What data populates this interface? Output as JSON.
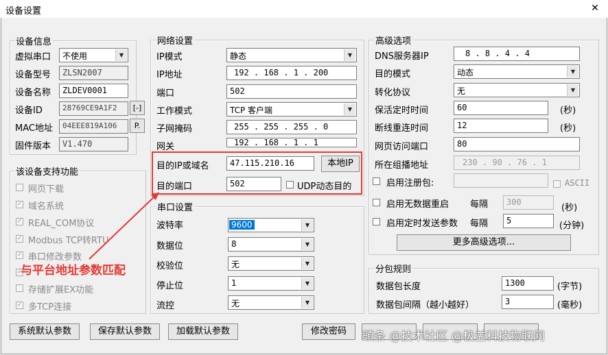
{
  "window": {
    "title": "设备设置",
    "close_icon": "✕"
  },
  "device_info": {
    "legend": "设备信息",
    "virtual_port": {
      "label": "虚拟串口",
      "value": "不使用"
    },
    "model": {
      "label": "设备型号",
      "value": "ZLSN2007"
    },
    "name": {
      "label": "设备名称",
      "value": "ZLDEV0001"
    },
    "id": {
      "label": "设备ID",
      "value": "28769CE9A1F2",
      "btn": "[-]"
    },
    "mac": {
      "label": "MAC地址",
      "value": "04EEE819A106",
      "btn": "P."
    },
    "firmware": {
      "label": "固件版本",
      "value": "V1.470"
    }
  },
  "features": {
    "legend": "该设备支持功能",
    "items": [
      "网页下载",
      "域名系统",
      "REAL_COM协议",
      "Modbus TCP转RTU",
      "串口修改参数",
      "",
      "存储扩展EX功能",
      "多TCP连接"
    ],
    "checked": [
      false,
      true,
      true,
      true,
      true,
      true,
      false,
      true
    ]
  },
  "network": {
    "legend": "网络设置",
    "ip_mode": {
      "label": "IP模式",
      "value": "静态"
    },
    "ip": {
      "label": "IP地址",
      "value": "192 . 168 . 1 . 200"
    },
    "port": {
      "label": "端口",
      "value": "502"
    },
    "work_mode": {
      "label": "工作模式",
      "value": "TCP 客户端"
    },
    "mask": {
      "label": "子网掩码",
      "value": "255 . 255 . 255 . 0"
    },
    "gateway": {
      "label": "网关",
      "value": "192 . 168 . 1 . 1"
    },
    "dest_ip": {
      "label": "目的IP或域名",
      "value": "47.115.210.16",
      "btn": "本地IP"
    },
    "dest_port": {
      "label": "目的端口",
      "value": "502"
    },
    "udp_dynamic": "UDP动态目的"
  },
  "serial": {
    "legend": "串口设置",
    "baud": {
      "label": "波特率",
      "value": "9600"
    },
    "data_bits": {
      "label": "数据位",
      "value": "8"
    },
    "parity": {
      "label": "校验位",
      "value": "无"
    },
    "stop_bits": {
      "label": "停止位",
      "value": "1"
    },
    "flow": {
      "label": "流控",
      "value": "无"
    }
  },
  "advanced": {
    "legend": "高级选项",
    "dns": {
      "label": "DNS服务器IP",
      "value": "8 . 8 . 4 . 4"
    },
    "dest_mode": {
      "label": "目的模式",
      "value": "动态"
    },
    "protocol": {
      "label": "转化协议",
      "value": "无"
    },
    "keepalive": {
      "label": "保活定时时间",
      "value": "60",
      "unit": "(秒)"
    },
    "reconnect": {
      "label": "断线重连时间",
      "value": "12",
      "unit": "(秒)"
    },
    "web_port": {
      "label": "网页访问端口",
      "value": "80"
    },
    "multicast": {
      "label": "所在组播地址",
      "value": "230 . 90 . 76 . 1"
    },
    "reg_pkt": {
      "label": "启用注册包:",
      "ascii": "ASCII"
    },
    "no_data_restart": {
      "label": "启用无数据重启",
      "every": "每隔",
      "value": "300",
      "unit": "(秒)"
    },
    "timed_send": {
      "label": "启用定时发送参数",
      "every": "每隔",
      "value": "5",
      "unit": "(分钟)"
    },
    "more_btn": "更多高级选项..."
  },
  "packet": {
    "legend": "分包规则",
    "length": {
      "label": "数据包长度",
      "value": "1300",
      "unit": "(字节)"
    },
    "interval": {
      "label": "数据包间隔（越小越好）",
      "value": "3",
      "unit": "(毫秒)"
    }
  },
  "buttons": {
    "sys_default": "系统默认参数",
    "save_default": "保存默认参数",
    "load_default": "加载默认参数",
    "change_pwd": "修改密码",
    "b5": "",
    "b6": "",
    "b7": ""
  },
  "annotation": {
    "text": "与平台地址参数匹配",
    "color": "#e53935"
  },
  "watermark": "頭条 @技术社区 @极益科技物联网"
}
